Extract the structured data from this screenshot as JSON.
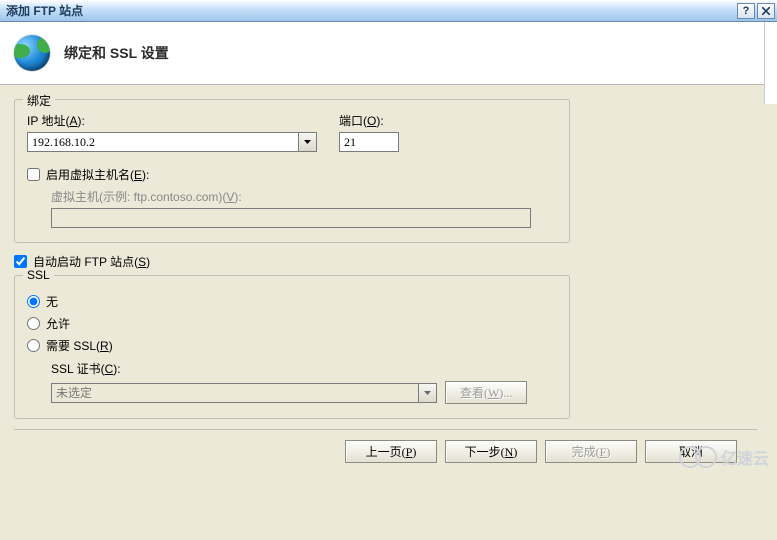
{
  "title": "添加 FTP 站点",
  "header_title": "绑定和 SSL 设置",
  "binding": {
    "legend": "绑定",
    "ip_label_pre": "IP 地址(",
    "ip_hot": "A",
    "ip_label_post": "):",
    "ip_value": "192.168.10.2",
    "port_label_pre": "端口(",
    "port_hot": "O",
    "port_label_post": "):",
    "port_value": "21",
    "vhost_check_label_pre": "启用虚拟主机名(",
    "vhost_check_hot": "E",
    "vhost_check_label_post": "):",
    "vhost_hint_pre": "虚拟主机(示例: ftp.contoso.com)(",
    "vhost_hint_hot": "V",
    "vhost_hint_post": "):",
    "vhost_value": ""
  },
  "autostart": {
    "label_pre": "自动启动 FTP 站点(",
    "hot": "S",
    "label_post": ")",
    "checked": true
  },
  "ssl": {
    "legend": "SSL",
    "opt_none": "无",
    "opt_allow": "允许",
    "opt_require_pre": "需要 SSL(",
    "opt_require_hot": "R",
    "opt_require_post": ")",
    "selected": "none",
    "cert_label_pre": "SSL 证书(",
    "cert_hot": "C",
    "cert_label_post": "):",
    "cert_value": "未选定",
    "view_label_pre": "查看(",
    "view_hot": "W",
    "view_label_post": ")..."
  },
  "buttons": {
    "prev_pre": "上一页(",
    "prev_hot": "P",
    "prev_post": ")",
    "next_pre": "下一步(",
    "next_hot": "N",
    "next_post": ")",
    "finish_pre": "完成(",
    "finish_hot": "F",
    "finish_post": ")",
    "cancel": "取消"
  },
  "watermark": "亿速云"
}
